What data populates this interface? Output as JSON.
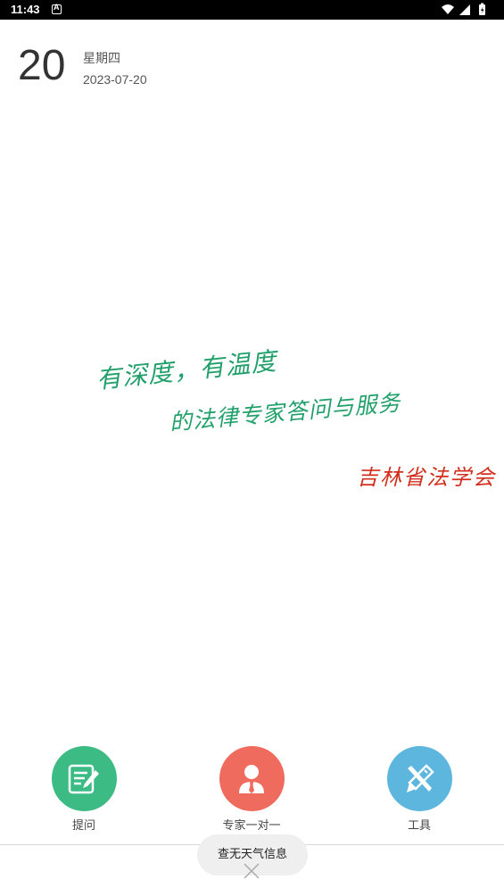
{
  "status_bar": {
    "time": "11:43",
    "icons": [
      "notification-a-icon",
      "wifi-icon",
      "signal-icon",
      "battery-icon"
    ]
  },
  "date": {
    "day": "20",
    "weekday": "星期四",
    "full_date": "2023-07-20"
  },
  "slogan": {
    "line1": "有深度，有温度",
    "line2": "的法律专家答问与服务",
    "signature": "吉林省法学会",
    "slogan_color": "#22a06b",
    "signature_color": "#d22f1e"
  },
  "actions": [
    {
      "label": "提问",
      "icon": "edit-note-icon",
      "color": "#3dbb84"
    },
    {
      "label": "专家一对一",
      "icon": "expert-person-icon",
      "color": "#ef6b5d"
    },
    {
      "label": "工具",
      "icon": "tools-icon",
      "color": "#5cb6dd"
    }
  ],
  "toast": {
    "message": "查无天气信息"
  }
}
